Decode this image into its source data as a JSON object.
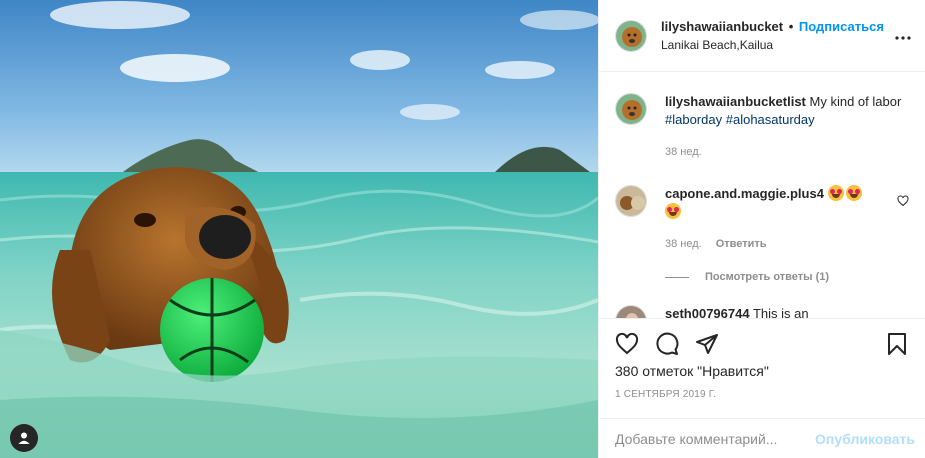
{
  "header": {
    "username": "lilyshawaiianbucket",
    "separator": "•",
    "follow_label": "Подписаться",
    "location": "Lanikai Beach,Kailua",
    "more_icon": "more-dots-icon"
  },
  "comments": [
    {
      "username": "lilyshawaiianbucketlist",
      "text": "My kind of labor",
      "tags": [
        "#laborday",
        "#alohasaturday"
      ],
      "time": "38 нед."
    },
    {
      "username": "capone.and.maggie.plus4",
      "emojis": [
        "heart-eyes-emoji",
        "heart-eyes-emoji",
        "heart-eyes-emoji"
      ],
      "time": "38 нед.",
      "reply_label": "Ответить",
      "view_replies_label": "Посмотреть ответы (1)"
    },
    {
      "username": "seth00796744",
      "text": "This is an"
    }
  ],
  "actions": {
    "like_icon": "heart-icon",
    "comment_icon": "comment-icon",
    "share_icon": "share-icon",
    "save_icon": "bookmark-icon",
    "likes_text": "380 отметок \"Нравится\"",
    "date": "1 сентября 2019 г."
  },
  "add_comment": {
    "placeholder": "Добавьте комментарий...",
    "publish_label": "Опубликовать"
  },
  "colors": {
    "accent": "#0095f6",
    "publish_disabled": "#b2dffc",
    "muted": "#8e8e8e",
    "tag": "#00376b"
  }
}
